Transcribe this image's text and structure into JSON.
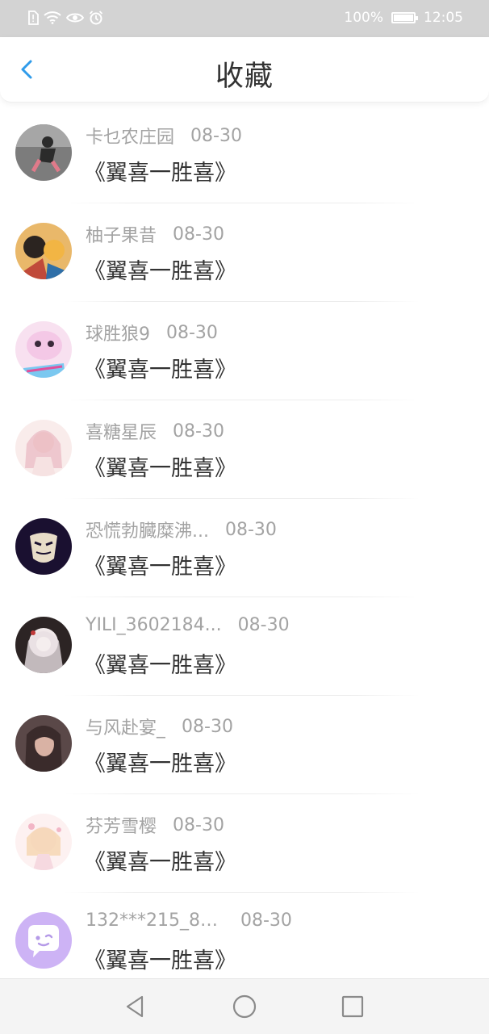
{
  "status_bar": {
    "battery": "100%",
    "time": "12:05"
  },
  "header": {
    "title": "收藏"
  },
  "items": [
    {
      "name": "卡乜农庄园",
      "date": "08-30",
      "content": "《翼喜一胜喜》",
      "avatar_colors": [
        "#2b2b2b",
        "#e07a8a"
      ]
    },
    {
      "name": "柚子果昔",
      "date": "08-30",
      "content": "《翼喜一胜喜》",
      "avatar_colors": [
        "#c04a3a",
        "#f2b544"
      ]
    },
    {
      "name": "球胜狼9",
      "date": "08-30",
      "content": "《翼喜一胜喜》",
      "avatar_colors": [
        "#f4c8e6",
        "#7bc8f0"
      ]
    },
    {
      "name": "喜糖星辰",
      "date": "08-30",
      "content": "《翼喜一胜喜》",
      "avatar_colors": [
        "#f6e2e2",
        "#e9b8c2"
      ]
    },
    {
      "name": "恐慌勃臓糜沸...",
      "date": "08-30",
      "content": "《翼喜一胜喜》",
      "avatar_colors": [
        "#1a1030",
        "#e8dcc8"
      ]
    },
    {
      "name": "YILI_3602184...",
      "date": "08-30",
      "content": "《翼喜一胜喜》",
      "avatar_colors": [
        "#2c2424",
        "#f1e9ea"
      ]
    },
    {
      "name": "与风赴宴_",
      "date": "08-30",
      "content": "《翼喜一胜喜》",
      "avatar_colors": [
        "#3a2b2b",
        "#d9b2a4"
      ]
    },
    {
      "name": "芬芳雪樱",
      "date": "08-30",
      "content": "《翼喜一胜喜》",
      "avatar_colors": [
        "#fbe7ea",
        "#f3d2a6"
      ]
    },
    {
      "name": "132***215_80...",
      "date": "08-30",
      "content": "《翼喜一胜喜》",
      "avatar_colors": [
        "#cdb3f5",
        "#ffffff"
      ]
    }
  ],
  "colors": {
    "accent": "#2f9bea",
    "status_bar_bg": "#d3d3d3"
  }
}
